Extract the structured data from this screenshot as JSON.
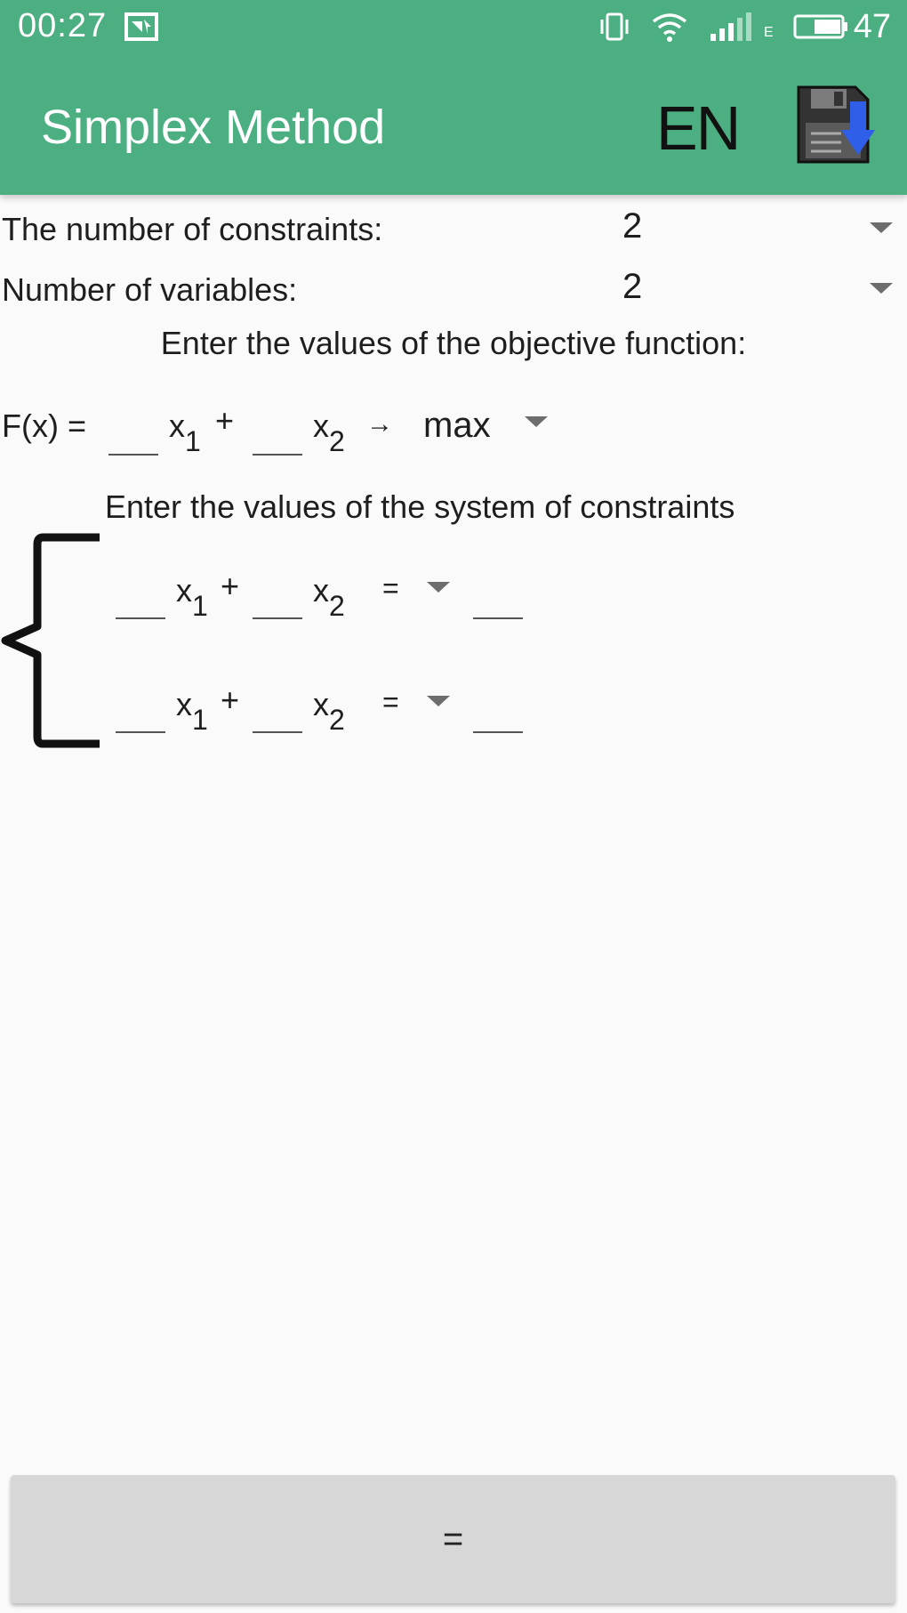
{
  "status_bar": {
    "time": "00:27",
    "network_label": "E",
    "battery": "47"
  },
  "app_bar": {
    "title": "Simplex Method",
    "language": "EN",
    "save_icon": "floppy-save-icon",
    "background_color": "#4caf82"
  },
  "settings": {
    "constraints_label": "The number of constraints:",
    "constraints_value": "2",
    "variables_label": "Number of variables:",
    "variables_value": "2"
  },
  "objective": {
    "prompt": "Enter the values of the objective function:",
    "prefix": "F(x) =",
    "var1": "x",
    "var1_sub": "1",
    "plus": "+",
    "var2": "x",
    "var2_sub": "2",
    "arrow": "→",
    "direction": "max"
  },
  "constraints": {
    "prompt": "Enter the values of the system of constraints",
    "rows": [
      {
        "var1": "x",
        "var1_sub": "1",
        "plus": "+",
        "var2": "x",
        "var2_sub": "2",
        "sign": "="
      },
      {
        "var1": "x",
        "var1_sub": "1",
        "plus": "+",
        "var2": "x",
        "var2_sub": "2",
        "sign": "="
      }
    ]
  },
  "actions": {
    "calculate_label": "="
  }
}
